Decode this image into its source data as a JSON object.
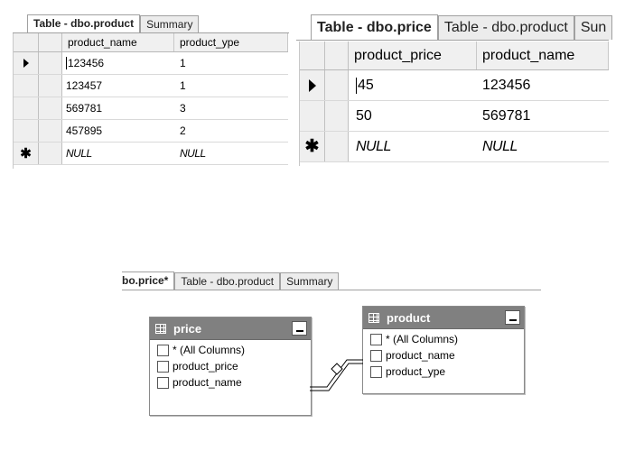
{
  "left_grid": {
    "tabs": [
      "Table - dbo.product",
      "Summary"
    ],
    "columns": [
      "product_name",
      "product_ype"
    ],
    "rows": [
      [
        "123456",
        "1"
      ],
      [
        "123457",
        "1"
      ],
      [
        "569781",
        "3"
      ],
      [
        "457895",
        "2"
      ]
    ],
    "new_row": [
      "NULL",
      "NULL"
    ]
  },
  "right_grid": {
    "tabs": [
      "Table - dbo.price",
      "Table - dbo.product",
      "Sun"
    ],
    "columns": [
      "product_price",
      "product_name"
    ],
    "rows": [
      [
        "45",
        "123456"
      ],
      [
        "50",
        "569781"
      ]
    ],
    "new_row": [
      "NULL",
      "NULL"
    ]
  },
  "designer": {
    "tabs": [
      "bo.price*",
      "Table - dbo.product",
      "Summary"
    ],
    "price_table": {
      "title": "price",
      "columns": [
        "* (All Columns)",
        "product_price",
        "product_name"
      ]
    },
    "product_table": {
      "title": "product",
      "columns": [
        "* (All Columns)",
        "product_name",
        "product_ype"
      ]
    }
  }
}
